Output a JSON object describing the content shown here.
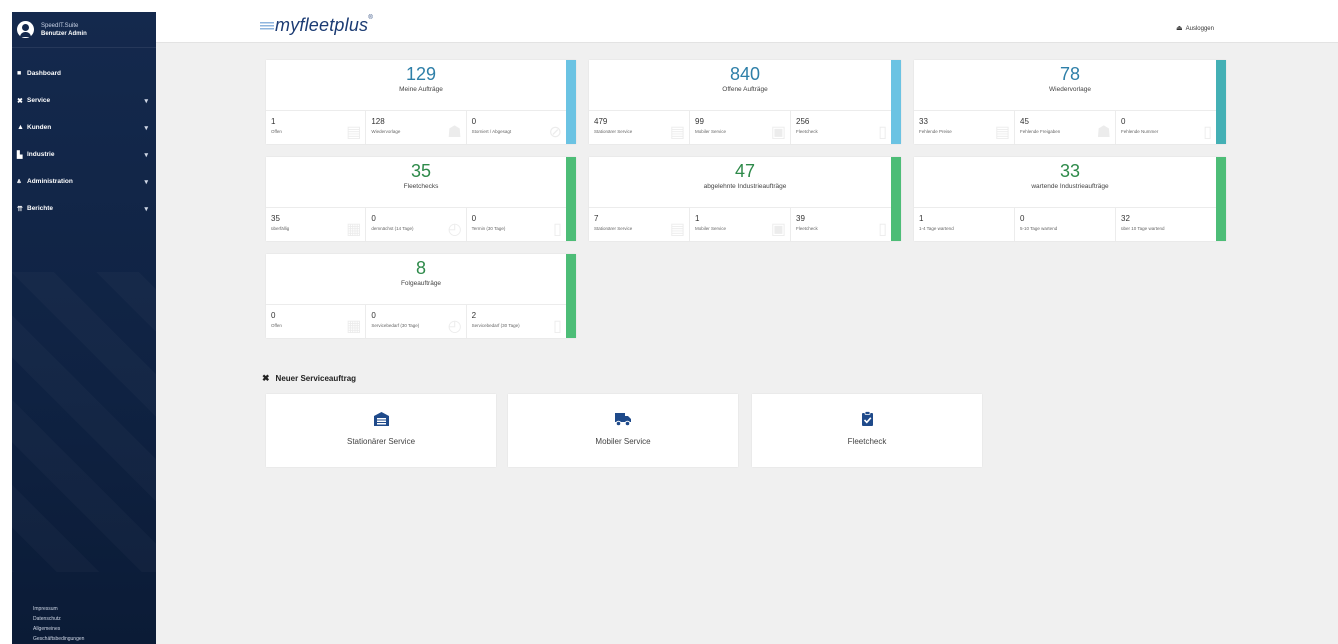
{
  "sidebar": {
    "user": {
      "line1": "SpeedIT.Suite",
      "line2": "Benutzer Admin"
    },
    "items": [
      {
        "label": "Dashboard",
        "icon": "dashboard-icon",
        "glyph": "■",
        "has_chevron": false
      },
      {
        "label": "Service",
        "icon": "wrench-icon",
        "glyph": "✖",
        "has_chevron": true
      },
      {
        "label": "Kunden",
        "icon": "user-icon",
        "glyph": "▲",
        "has_chevron": true
      },
      {
        "label": "Industrie",
        "icon": "factory-icon",
        "glyph": "▙",
        "has_chevron": true
      },
      {
        "label": "Administration",
        "icon": "users-admin-icon",
        "glyph": "⩓",
        "has_chevron": true
      },
      {
        "label": "Berichte",
        "icon": "report-icon",
        "glyph": "⇈",
        "has_chevron": true
      }
    ],
    "footer": [
      "Impressum",
      "Datenschutz",
      "Allgemeines",
      "Geschäftsbedingungen"
    ]
  },
  "topbar": {
    "logo": "myfleetplus",
    "logout_label": "Ausloggen",
    "logout_icon": "logout-icon"
  },
  "colors": {
    "blue_accent": "#6bc3e3",
    "teal_accent": "#44b0b5",
    "green_accent": "#4dbd77",
    "blue_number": "#2e7fa8",
    "green_number": "#2e8a4a"
  },
  "cards": [
    {
      "number": "129",
      "title": "Meine Aufträge",
      "theme": "blue",
      "stats": [
        {
          "value": "1",
          "label": "Offen"
        },
        {
          "value": "128",
          "label": "Wiedervorlage"
        },
        {
          "value": "0",
          "label": "Storniert / Abgesagt"
        }
      ]
    },
    {
      "number": "840",
      "title": "Offene Aufträge",
      "theme": "blue",
      "stats": [
        {
          "value": "479",
          "label": "Stationärer Service"
        },
        {
          "value": "99",
          "label": "Mobiler Service"
        },
        {
          "value": "256",
          "label": "Fleetcheck"
        }
      ]
    },
    {
      "number": "78",
      "title": "Wiedervorlage",
      "theme": "teal",
      "stats": [
        {
          "value": "33",
          "label": "Fehlende Preise"
        },
        {
          "value": "45",
          "label": "Fehlende Freigaben"
        },
        {
          "value": "0",
          "label": "Fehlende Nummer"
        }
      ]
    },
    {
      "number": "35",
      "title": "Fleetchecks",
      "theme": "green",
      "stats": [
        {
          "value": "35",
          "label": "überfällig"
        },
        {
          "value": "0",
          "label": "demnächst (14 Tage)"
        },
        {
          "value": "0",
          "label": "Termin (30 Tage)"
        }
      ]
    },
    {
      "number": "47",
      "title": "abgelehnte Industrieaufträge",
      "theme": "green",
      "stats": [
        {
          "value": "7",
          "label": "Stationärer Service"
        },
        {
          "value": "1",
          "label": "Mobiler Service"
        },
        {
          "value": "39",
          "label": "Fleetcheck"
        }
      ]
    },
    {
      "number": "33",
      "title": "wartende Industrieaufträge",
      "theme": "green",
      "stats": [
        {
          "value": "1",
          "label": "1-4 Tage wartend"
        },
        {
          "value": "0",
          "label": "5-10 Tage wartend"
        },
        {
          "value": "32",
          "label": "über 10 Tage wartend"
        }
      ]
    },
    {
      "number": "8",
      "title": "Folgeaufträge",
      "theme": "green",
      "stats": [
        {
          "value": "0",
          "label": "Offen"
        },
        {
          "value": "0",
          "label": "Servicebedarf (30 Tage)"
        },
        {
          "value": "2",
          "label": "Servicebedarf (30 Tage)"
        }
      ]
    }
  ],
  "new_service": {
    "title": "Neuer Serviceauftrag",
    "options": [
      {
        "label": "Stationärer Service",
        "icon": "garage-icon"
      },
      {
        "label": "Mobiler Service",
        "icon": "truck-icon"
      },
      {
        "label": "Fleetcheck",
        "icon": "clipboard-check-icon"
      }
    ]
  }
}
